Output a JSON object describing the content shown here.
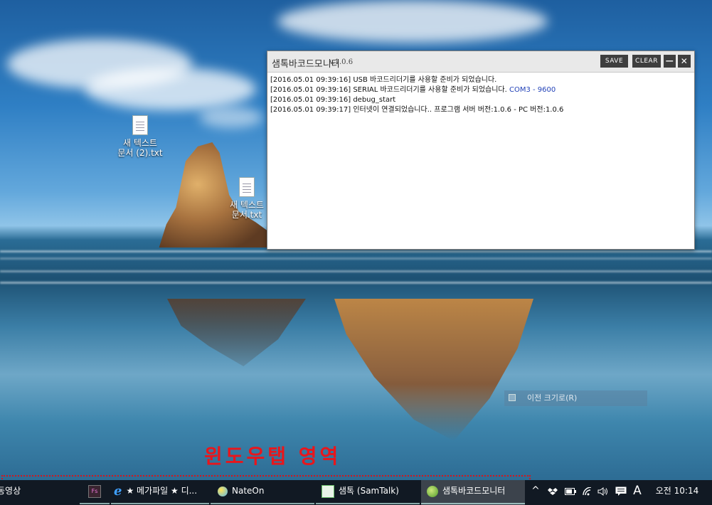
{
  "desktop": {
    "icons": [
      {
        "label_line1": "새 텍스트",
        "label_line2": "문서 (2).txt"
      },
      {
        "label_line1": "새 텍스트",
        "label_line2": "문서.txt"
      }
    ]
  },
  "app_window": {
    "title": "샘톡바코드모니터",
    "version": "v.1.0.6",
    "buttons": {
      "save": "SAVE",
      "clear": "CLEAR",
      "minimize": "—",
      "close": "✕"
    },
    "log_lines": [
      {
        "text": "[2016.05.01 09:39:16] USB 바코드리더기를 사용할 준비가 되었습니다."
      },
      {
        "text": "[2016.05.01 09:39:16] SERIAL 바코드리더기를 사용할 준비가 되었습니다. ",
        "port": "COM3 - 9600"
      },
      {
        "text": "[2016.05.01 09:39:16] debug_start"
      },
      {
        "text": "[2016.05.01 09:39:17] 인터넷이 연결되었습니다.. 프로그램 서버 버전:1.0.6 - PC 버전:1.0.6"
      }
    ]
  },
  "undo_size_button": {
    "label": "이전 크기로(R)"
  },
  "annotation": {
    "label": "윈도우탭 영역"
  },
  "taskbar": {
    "items": [
      {
        "label": "동영상",
        "icon": "video-icon"
      },
      {
        "label": "",
        "icon": "fs-app-icon",
        "icon_text": "Fs"
      },
      {
        "label": "★ 메가파일 ★ 디...",
        "icon": "internet-explorer-icon"
      },
      {
        "label": "NateOn",
        "icon": "nateon-icon"
      },
      {
        "label": "샘톡 (SamTalk)",
        "icon": "samtalk-icon"
      },
      {
        "label": "샘톡바코드모니터",
        "icon": "barcode-monitor-icon"
      }
    ],
    "tray": {
      "chevron": "^",
      "ime": "A",
      "clock": "오전 10:14"
    }
  },
  "colors": {
    "accent_red": "#e8161c",
    "port_blue": "#2242b8",
    "taskbar_bg": "#111923"
  }
}
